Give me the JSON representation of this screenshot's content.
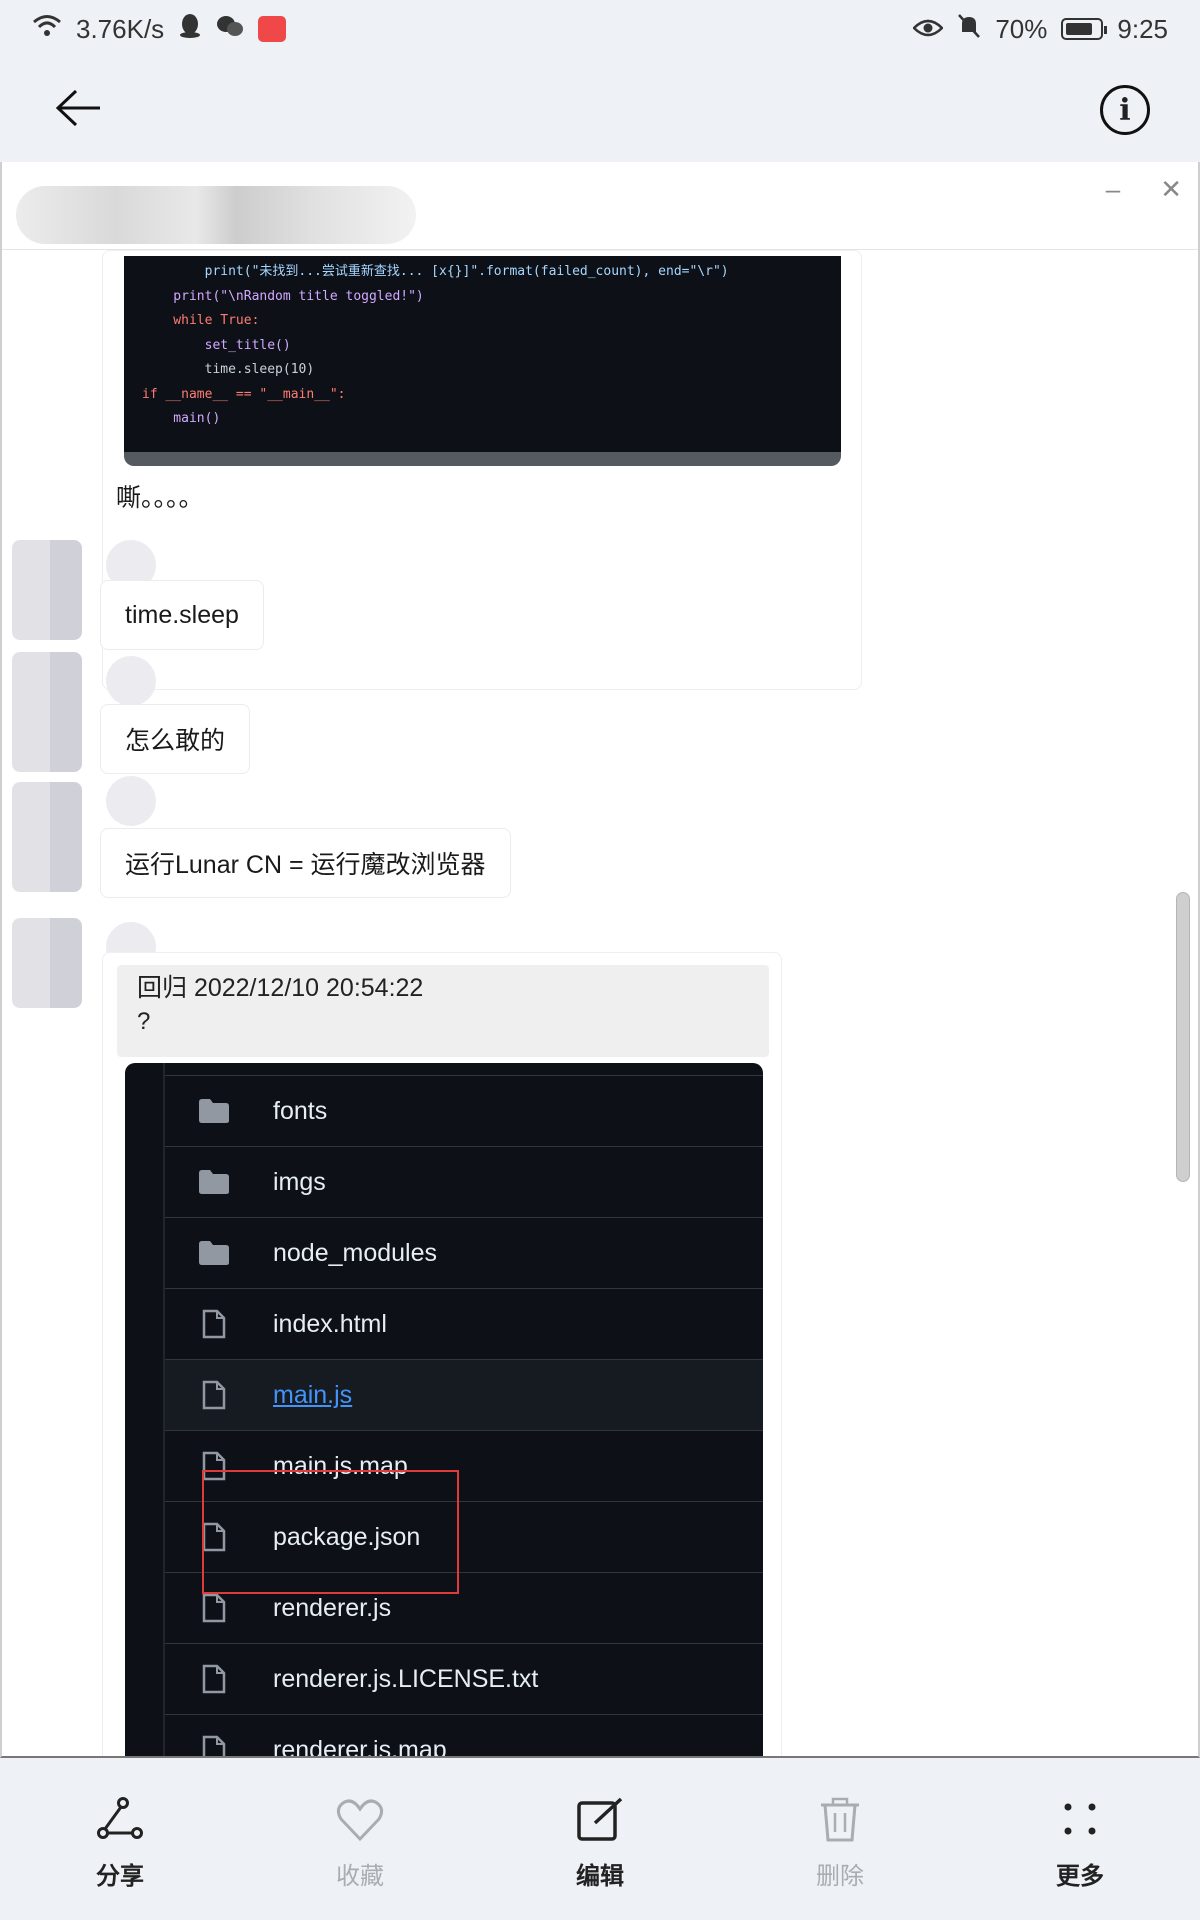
{
  "status_bar": {
    "net_speed": "3.76K/s",
    "battery": "70%",
    "time": "9:25"
  },
  "top_bar": {
    "back_icon": "arrow-left-icon",
    "info_icon": "info-circle-icon"
  },
  "screenshot": {
    "code_lines": [
      "        print(\"未找到...尝试重新查找... [x{}]\".format(failed_count), end=\"\\r\")",
      "    print(\"\\nRandom title toggled!\")",
      "    while True:",
      "        set_title()",
      "        time.sleep(10)",
      "",
      "if __name__ == \"__main__\":",
      "    main()"
    ],
    "message_caption": "嘶。。。。",
    "bubbles": [
      "time.sleep",
      "怎么敢的",
      "运行Lunar CN = 运行魔改浏览器"
    ],
    "reply": {
      "quote_header": "回归  2022/12/10 20:54:22",
      "quote_text": "?"
    },
    "files": [
      {
        "name": "fonts",
        "type": "folder"
      },
      {
        "name": "imgs",
        "type": "folder"
      },
      {
        "name": "node_modules",
        "type": "folder"
      },
      {
        "name": "index.html",
        "type": "file"
      },
      {
        "name": "main.js",
        "type": "file",
        "link": true
      },
      {
        "name": "main.js.map",
        "type": "file"
      },
      {
        "name": "package.json",
        "type": "file"
      },
      {
        "name": "renderer.js",
        "type": "file"
      },
      {
        "name": "renderer.js.LICENSE.txt",
        "type": "file"
      },
      {
        "name": "renderer.js.map",
        "type": "file"
      }
    ]
  },
  "actions": [
    {
      "label": "分享",
      "icon": "share-icon",
      "enabled": true
    },
    {
      "label": "收藏",
      "icon": "heart-icon",
      "enabled": false
    },
    {
      "label": "编辑",
      "icon": "edit-icon",
      "enabled": true
    },
    {
      "label": "删除",
      "icon": "trash-icon",
      "enabled": false
    },
    {
      "label": "更多",
      "icon": "more-icon",
      "enabled": true
    }
  ],
  "colors": {
    "accent_red": "#e03a3a",
    "link_blue": "#4493f8",
    "code_bg": "#0d1117"
  }
}
